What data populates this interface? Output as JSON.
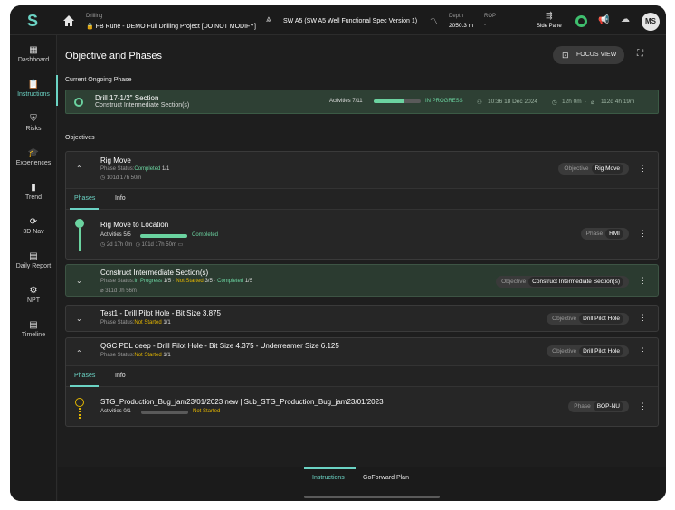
{
  "topbar": {
    "app_icon": "s-logo-icon",
    "project_sub": "Drilling",
    "project_name": "FB Rune - DEMO Full Drilling Project [DO NOT MODIFY]",
    "well_name": "SW A5 (SW A5 Well Functional Spec Version 1)",
    "depth_label": "Depth",
    "depth_value": "2050.3 m",
    "rop_label": "ROP",
    "rop_value": "-",
    "side_pane_label": "Side Pane",
    "avatar_initials": "MS"
  },
  "sidebar": {
    "items": [
      {
        "label": "Dashboard",
        "icon": "dashboard-icon"
      },
      {
        "label": "Instructions",
        "icon": "clipboard-icon"
      },
      {
        "label": "Risks",
        "icon": "shield-icon"
      },
      {
        "label": "Experiences",
        "icon": "graduation-cap-icon"
      },
      {
        "label": "Trend",
        "icon": "bar-chart-icon"
      },
      {
        "label": "3D Nav",
        "icon": "rotate-3d-icon"
      },
      {
        "label": "Daily Report",
        "icon": "report-icon"
      },
      {
        "label": "NPT",
        "icon": "gear-clock-icon"
      },
      {
        "label": "Timeline",
        "icon": "timeline-icon"
      }
    ]
  },
  "page": {
    "title": "Objective and Phases",
    "focus_view": "FOCUS VIEW",
    "current_phase_label": "Current Ongoing Phase",
    "objectives_label": "Objectives"
  },
  "ongoing": {
    "title": "Drill 17-1/2\" Section",
    "subtitle": "Construct Intermediate Section(s)",
    "activities": "Activities 7/11",
    "progress": 0.64,
    "status": "IN PROGRESS",
    "time": "10:36 18 Dec 2024",
    "duration": "12h 0m",
    "elapsed": "112d 4h 19m"
  },
  "objectives": [
    {
      "title": "Rig Move",
      "status_prefix": "Phase Status:",
      "status_completed": "Completed",
      "status_completed_count": "1/1",
      "duration": "101d 17h 50m",
      "badge_key": "Objective",
      "badge_value": "Rig Move",
      "tabs": [
        "Phases",
        "Info"
      ],
      "phase": {
        "title": "Rig Move to Location",
        "activities": "Activities 5/5",
        "progress": 1.0,
        "status": "Completed",
        "duration": "2d 17h 0m",
        "elapsed": "101d 17h 50m",
        "badge_key": "Phase",
        "badge_value": "RMI"
      }
    },
    {
      "title": "Construct Intermediate Section(s)",
      "status_prefix": "Phase Status:",
      "status_inprogress": "In Progress",
      "status_inprogress_count": "1/5",
      "status_notstarted": "Not Started",
      "status_notstarted_count": "3/5",
      "status_completed": "Completed",
      "status_completed_count": "1/5",
      "duration": "311d 0h 56m",
      "badge_key": "Objective",
      "badge_value": "Construct Intermediate Section(s)"
    },
    {
      "title": "Test1 - Drill Pilot Hole - Bit Size 3.875",
      "status_prefix": "Phase Status:",
      "status_notstarted": "Not Started",
      "status_notstarted_count": "1/1",
      "badge_key": "Objective",
      "badge_value": "Drill Pilot Hole"
    },
    {
      "title": "QGC PDL deep - Drill Pilot Hole - Bit Size 4.375 - Underreamer Size 6.125",
      "status_prefix": "Phase Status:",
      "status_notstarted": "Not Started",
      "status_notstarted_count": "1/1",
      "badge_key": "Objective",
      "badge_value": "Drill Pilot Hole",
      "tabs": [
        "Phases",
        "Info"
      ],
      "phase": {
        "title": "STG_Production_Bug_jam23/01/2023 new | Sub_STG_Production_Bug_jam23/01/2023",
        "activities": "Activities 0/1",
        "progress": 0.0,
        "status": "Not Started",
        "badge_key": "Phase",
        "badge_value": "BOP-NU"
      }
    }
  ],
  "bottom_tabs": [
    "Instructions",
    "GoForward Plan"
  ],
  "colors": {
    "accent": "#6bd3c4",
    "green": "#6bd3a0",
    "yellow": "#e1b400"
  }
}
